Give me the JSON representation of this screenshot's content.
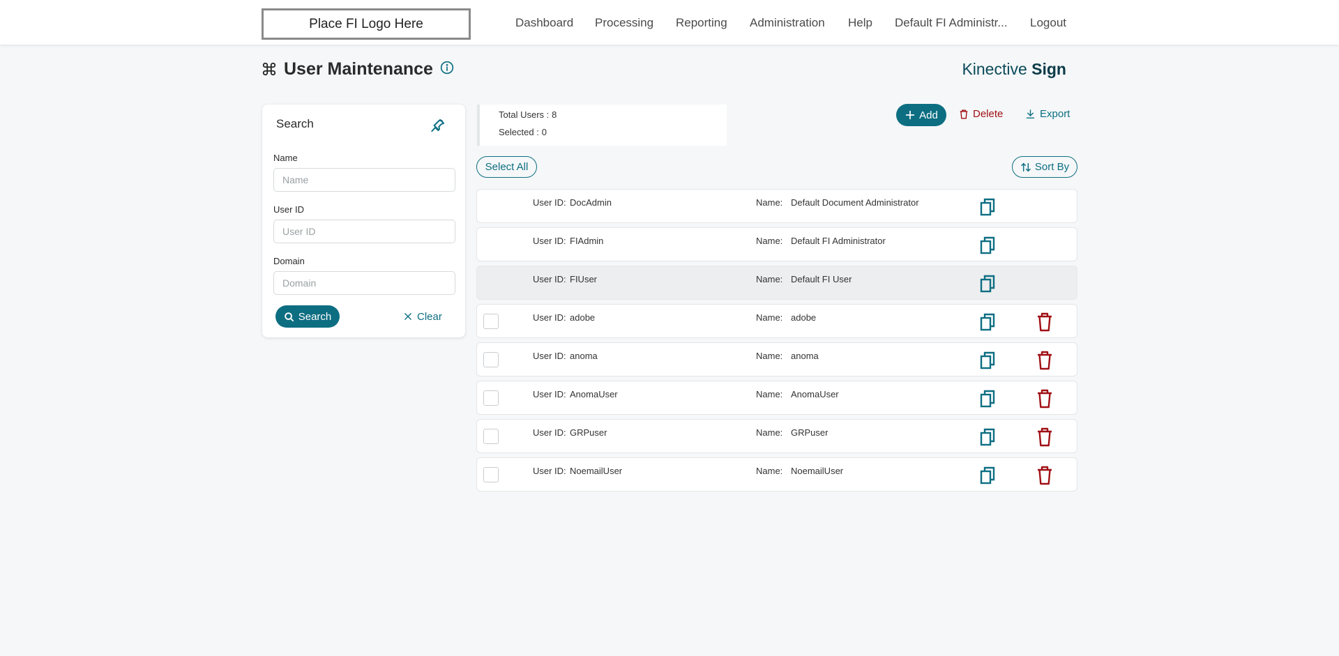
{
  "header": {
    "logo_text": "Place FI Logo Here",
    "nav": [
      {
        "label": "Dashboard"
      },
      {
        "label": "Processing"
      },
      {
        "label": "Reporting"
      },
      {
        "label": "Administration"
      },
      {
        "label": "Help"
      },
      {
        "label": "Default FI Administr..."
      },
      {
        "label": "Logout"
      }
    ]
  },
  "page": {
    "title": "User Maintenance",
    "brand_light": "Kinective",
    "brand_bold": "Sign"
  },
  "search": {
    "title": "Search",
    "name_label": "Name",
    "name_placeholder": "Name",
    "name_value": "",
    "userid_label": "User ID",
    "userid_placeholder": "User ID",
    "userid_value": "",
    "domain_label": "Domain",
    "domain_placeholder": "Domain",
    "domain_value": "",
    "search_button": "Search",
    "clear_button": "Clear"
  },
  "summary": {
    "total_label": "Total Users :",
    "total_value": "8",
    "selected_label": "Selected :",
    "selected_value": "0"
  },
  "toolbar": {
    "add_label": "Add",
    "delete_label": "Delete",
    "export_label": "Export",
    "select_all_label": "Select All",
    "sort_by_label": "Sort By"
  },
  "colors": {
    "primary": "#0d6e82",
    "danger": "#a01015",
    "brand": "#0b4a5a"
  },
  "users": [
    {
      "userid_label": "User ID:",
      "userid": "DocAdmin",
      "name_label": "Name:",
      "name": "Default Document Administrator",
      "selectable": false,
      "deletable": false,
      "highlight": false
    },
    {
      "userid_label": "User ID:",
      "userid": "FIAdmin",
      "name_label": "Name:",
      "name": "Default FI Administrator",
      "selectable": false,
      "deletable": false,
      "highlight": false
    },
    {
      "userid_label": "User ID:",
      "userid": "FIUser",
      "name_label": "Name:",
      "name": "Default FI User",
      "selectable": false,
      "deletable": false,
      "highlight": true
    },
    {
      "userid_label": "User ID:",
      "userid": "adobe",
      "name_label": "Name:",
      "name": "adobe",
      "selectable": true,
      "deletable": true,
      "highlight": false
    },
    {
      "userid_label": "User ID:",
      "userid": "anoma",
      "name_label": "Name:",
      "name": "anoma",
      "selectable": true,
      "deletable": true,
      "highlight": false
    },
    {
      "userid_label": "User ID:",
      "userid": "AnomaUser",
      "name_label": "Name:",
      "name": "AnomaUser",
      "selectable": true,
      "deletable": true,
      "highlight": false
    },
    {
      "userid_label": "User ID:",
      "userid": "GRPuser",
      "name_label": "Name:",
      "name": "GRPuser",
      "selectable": true,
      "deletable": true,
      "highlight": false
    },
    {
      "userid_label": "User ID:",
      "userid": "NoemailUser",
      "name_label": "Name:",
      "name": "NoemailUser",
      "selectable": true,
      "deletable": true,
      "highlight": false
    }
  ]
}
